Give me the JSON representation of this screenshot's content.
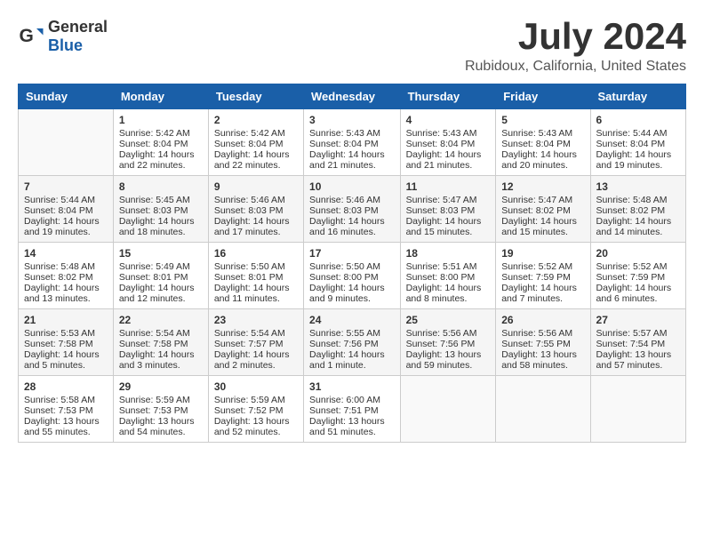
{
  "header": {
    "logo_general": "General",
    "logo_blue": "Blue",
    "month_title": "July 2024",
    "location": "Rubidoux, California, United States"
  },
  "weekdays": [
    "Sunday",
    "Monday",
    "Tuesday",
    "Wednesday",
    "Thursday",
    "Friday",
    "Saturday"
  ],
  "weeks": [
    [
      {
        "day": "",
        "lines": []
      },
      {
        "day": "1",
        "lines": [
          "Sunrise: 5:42 AM",
          "Sunset: 8:04 PM",
          "Daylight: 14 hours",
          "and 22 minutes."
        ]
      },
      {
        "day": "2",
        "lines": [
          "Sunrise: 5:42 AM",
          "Sunset: 8:04 PM",
          "Daylight: 14 hours",
          "and 22 minutes."
        ]
      },
      {
        "day": "3",
        "lines": [
          "Sunrise: 5:43 AM",
          "Sunset: 8:04 PM",
          "Daylight: 14 hours",
          "and 21 minutes."
        ]
      },
      {
        "day": "4",
        "lines": [
          "Sunrise: 5:43 AM",
          "Sunset: 8:04 PM",
          "Daylight: 14 hours",
          "and 21 minutes."
        ]
      },
      {
        "day": "5",
        "lines": [
          "Sunrise: 5:43 AM",
          "Sunset: 8:04 PM",
          "Daylight: 14 hours",
          "and 20 minutes."
        ]
      },
      {
        "day": "6",
        "lines": [
          "Sunrise: 5:44 AM",
          "Sunset: 8:04 PM",
          "Daylight: 14 hours",
          "and 19 minutes."
        ]
      }
    ],
    [
      {
        "day": "7",
        "lines": [
          "Sunrise: 5:44 AM",
          "Sunset: 8:04 PM",
          "Daylight: 14 hours",
          "and 19 minutes."
        ]
      },
      {
        "day": "8",
        "lines": [
          "Sunrise: 5:45 AM",
          "Sunset: 8:03 PM",
          "Daylight: 14 hours",
          "and 18 minutes."
        ]
      },
      {
        "day": "9",
        "lines": [
          "Sunrise: 5:46 AM",
          "Sunset: 8:03 PM",
          "Daylight: 14 hours",
          "and 17 minutes."
        ]
      },
      {
        "day": "10",
        "lines": [
          "Sunrise: 5:46 AM",
          "Sunset: 8:03 PM",
          "Daylight: 14 hours",
          "and 16 minutes."
        ]
      },
      {
        "day": "11",
        "lines": [
          "Sunrise: 5:47 AM",
          "Sunset: 8:03 PM",
          "Daylight: 14 hours",
          "and 15 minutes."
        ]
      },
      {
        "day": "12",
        "lines": [
          "Sunrise: 5:47 AM",
          "Sunset: 8:02 PM",
          "Daylight: 14 hours",
          "and 15 minutes."
        ]
      },
      {
        "day": "13",
        "lines": [
          "Sunrise: 5:48 AM",
          "Sunset: 8:02 PM",
          "Daylight: 14 hours",
          "and 14 minutes."
        ]
      }
    ],
    [
      {
        "day": "14",
        "lines": [
          "Sunrise: 5:48 AM",
          "Sunset: 8:02 PM",
          "Daylight: 14 hours",
          "and 13 minutes."
        ]
      },
      {
        "day": "15",
        "lines": [
          "Sunrise: 5:49 AM",
          "Sunset: 8:01 PM",
          "Daylight: 14 hours",
          "and 12 minutes."
        ]
      },
      {
        "day": "16",
        "lines": [
          "Sunrise: 5:50 AM",
          "Sunset: 8:01 PM",
          "Daylight: 14 hours",
          "and 11 minutes."
        ]
      },
      {
        "day": "17",
        "lines": [
          "Sunrise: 5:50 AM",
          "Sunset: 8:00 PM",
          "Daylight: 14 hours",
          "and 9 minutes."
        ]
      },
      {
        "day": "18",
        "lines": [
          "Sunrise: 5:51 AM",
          "Sunset: 8:00 PM",
          "Daylight: 14 hours",
          "and 8 minutes."
        ]
      },
      {
        "day": "19",
        "lines": [
          "Sunrise: 5:52 AM",
          "Sunset: 7:59 PM",
          "Daylight: 14 hours",
          "and 7 minutes."
        ]
      },
      {
        "day": "20",
        "lines": [
          "Sunrise: 5:52 AM",
          "Sunset: 7:59 PM",
          "Daylight: 14 hours",
          "and 6 minutes."
        ]
      }
    ],
    [
      {
        "day": "21",
        "lines": [
          "Sunrise: 5:53 AM",
          "Sunset: 7:58 PM",
          "Daylight: 14 hours",
          "and 5 minutes."
        ]
      },
      {
        "day": "22",
        "lines": [
          "Sunrise: 5:54 AM",
          "Sunset: 7:58 PM",
          "Daylight: 14 hours",
          "and 3 minutes."
        ]
      },
      {
        "day": "23",
        "lines": [
          "Sunrise: 5:54 AM",
          "Sunset: 7:57 PM",
          "Daylight: 14 hours",
          "and 2 minutes."
        ]
      },
      {
        "day": "24",
        "lines": [
          "Sunrise: 5:55 AM",
          "Sunset: 7:56 PM",
          "Daylight: 14 hours",
          "and 1 minute."
        ]
      },
      {
        "day": "25",
        "lines": [
          "Sunrise: 5:56 AM",
          "Sunset: 7:56 PM",
          "Daylight: 13 hours",
          "and 59 minutes."
        ]
      },
      {
        "day": "26",
        "lines": [
          "Sunrise: 5:56 AM",
          "Sunset: 7:55 PM",
          "Daylight: 13 hours",
          "and 58 minutes."
        ]
      },
      {
        "day": "27",
        "lines": [
          "Sunrise: 5:57 AM",
          "Sunset: 7:54 PM",
          "Daylight: 13 hours",
          "and 57 minutes."
        ]
      }
    ],
    [
      {
        "day": "28",
        "lines": [
          "Sunrise: 5:58 AM",
          "Sunset: 7:53 PM",
          "Daylight: 13 hours",
          "and 55 minutes."
        ]
      },
      {
        "day": "29",
        "lines": [
          "Sunrise: 5:59 AM",
          "Sunset: 7:53 PM",
          "Daylight: 13 hours",
          "and 54 minutes."
        ]
      },
      {
        "day": "30",
        "lines": [
          "Sunrise: 5:59 AM",
          "Sunset: 7:52 PM",
          "Daylight: 13 hours",
          "and 52 minutes."
        ]
      },
      {
        "day": "31",
        "lines": [
          "Sunrise: 6:00 AM",
          "Sunset: 7:51 PM",
          "Daylight: 13 hours",
          "and 51 minutes."
        ]
      },
      {
        "day": "",
        "lines": []
      },
      {
        "day": "",
        "lines": []
      },
      {
        "day": "",
        "lines": []
      }
    ]
  ]
}
